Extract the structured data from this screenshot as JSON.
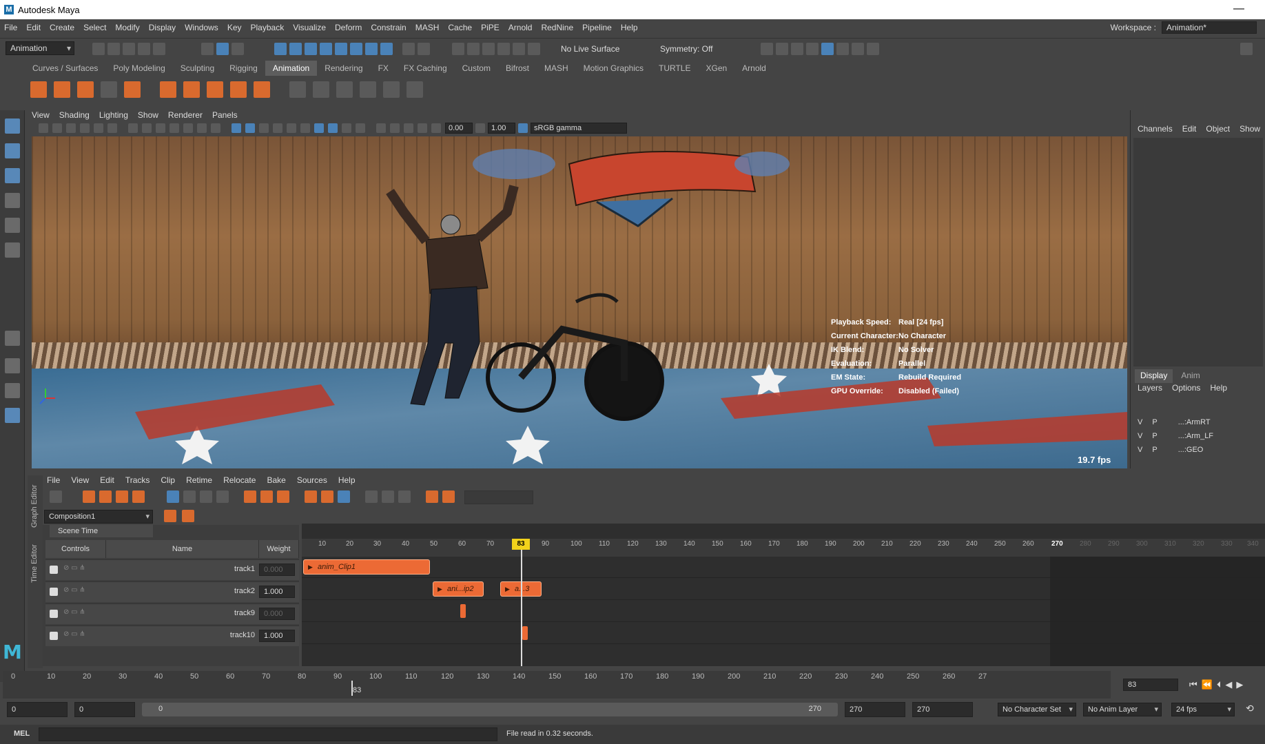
{
  "app": {
    "title": "Autodesk Maya",
    "logo_letter": "M"
  },
  "menubar": {
    "items": [
      "File",
      "Edit",
      "Create",
      "Select",
      "Modify",
      "Display",
      "Windows",
      "Key",
      "Playback",
      "Visualize",
      "Deform",
      "Constrain",
      "MASH",
      "Cache",
      "PiPE",
      "Arnold",
      "RedNine",
      "Pipeline",
      "Help"
    ],
    "workspace_label": "Workspace :",
    "workspace_value": "Animation*"
  },
  "statusline": {
    "menuset": "Animation",
    "live_surface": "No Live Surface",
    "symmetry": "Symmetry: Off"
  },
  "shelf": {
    "tabs": [
      "Curves / Surfaces",
      "Poly Modeling",
      "Sculpting",
      "Rigging",
      "Animation",
      "Rendering",
      "FX",
      "FX Caching",
      "Custom",
      "Bifrost",
      "MASH",
      "Motion Graphics",
      "TURTLE",
      "XGen",
      "Arnold"
    ],
    "active_tab": "Animation"
  },
  "viewport": {
    "menu": [
      "View",
      "Shading",
      "Lighting",
      "Show",
      "Renderer",
      "Panels"
    ],
    "exposure": "0.00",
    "gamma": "1.00",
    "color_space": "sRGB gamma",
    "hud": [
      {
        "label": "Playback Speed:",
        "value": "Real [24 fps]"
      },
      {
        "label": "Current Character:",
        "value": "No Character"
      },
      {
        "label": "IK Blend:",
        "value": "No Solver"
      },
      {
        "label": "Evaluation:",
        "value": "Parallel"
      },
      {
        "label": "EM State:",
        "value": "Rebuild Required"
      },
      {
        "label": "GPU Override:",
        "value": "Disabled (Failed)"
      }
    ],
    "fps": "19.7 fps"
  },
  "channel_box": {
    "menu": [
      "Channels",
      "Edit",
      "Object",
      "Show"
    ],
    "layer_tabs": [
      "Display",
      "Anim"
    ],
    "layer_menu": [
      "Layers",
      "Options",
      "Help"
    ],
    "layers": [
      {
        "v": "V",
        "p": "P",
        "name": "...:ArmRT"
      },
      {
        "v": "V",
        "p": "P",
        "name": "...:Arm_LF"
      },
      {
        "v": "V",
        "p": "P",
        "name": "...:GEO"
      }
    ]
  },
  "time_editor": {
    "side_labels": [
      "Graph Editor",
      "Time Editor"
    ],
    "menu": [
      "File",
      "View",
      "Edit",
      "Tracks",
      "Clip",
      "Retime",
      "Relocate",
      "Bake",
      "Sources",
      "Help"
    ],
    "composition": "Composition1",
    "scene_time_label": "Scene Time",
    "columns": [
      "Controls",
      "Name",
      "Weight"
    ],
    "tracks": [
      {
        "name": "track1",
        "weight": "0.000"
      },
      {
        "name": "track2",
        "weight": "1.000"
      },
      {
        "name": "track9",
        "weight": "0.000"
      },
      {
        "name": "track10",
        "weight": "1.000"
      }
    ],
    "ruler_ticks": [
      "10",
      "20",
      "30",
      "40",
      "50",
      "60",
      "70",
      "90",
      "100",
      "110",
      "120",
      "130",
      "140",
      "150",
      "160",
      "170",
      "180",
      "190",
      "200",
      "210",
      "220",
      "230",
      "240",
      "250",
      "260",
      "270",
      "280",
      "290",
      "300",
      "310",
      "320",
      "330",
      "340"
    ],
    "current_frame": "83",
    "clips": [
      {
        "label": "anim_Clip1"
      },
      {
        "label": "ani...ip2"
      },
      {
        "label": "a...3"
      }
    ]
  },
  "time_slider": {
    "ticks": [
      "0",
      "10",
      "20",
      "30",
      "40",
      "50",
      "60",
      "70",
      "80",
      "90",
      "100",
      "110",
      "120",
      "130",
      "140",
      "150",
      "160",
      "170",
      "180",
      "190",
      "200",
      "210",
      "220",
      "230",
      "240",
      "250",
      "260",
      "27"
    ],
    "current": "83",
    "current_field": "83"
  },
  "range": {
    "start": "0",
    "inner_start": "0",
    "slider_start": "0",
    "slider_end": "270",
    "inner_end": "270",
    "end": "270",
    "character_set": "No Character Set",
    "anim_layer": "No Anim Layer",
    "fps": "24 fps"
  },
  "mel": {
    "label": "MEL",
    "status": "File read in  0.32 seconds."
  },
  "colors": {
    "accent_orange": "#ec6a35",
    "playhead_yellow": "#f2d21b",
    "ui_dark": "#444444",
    "selection_blue": "#4a82b8"
  }
}
